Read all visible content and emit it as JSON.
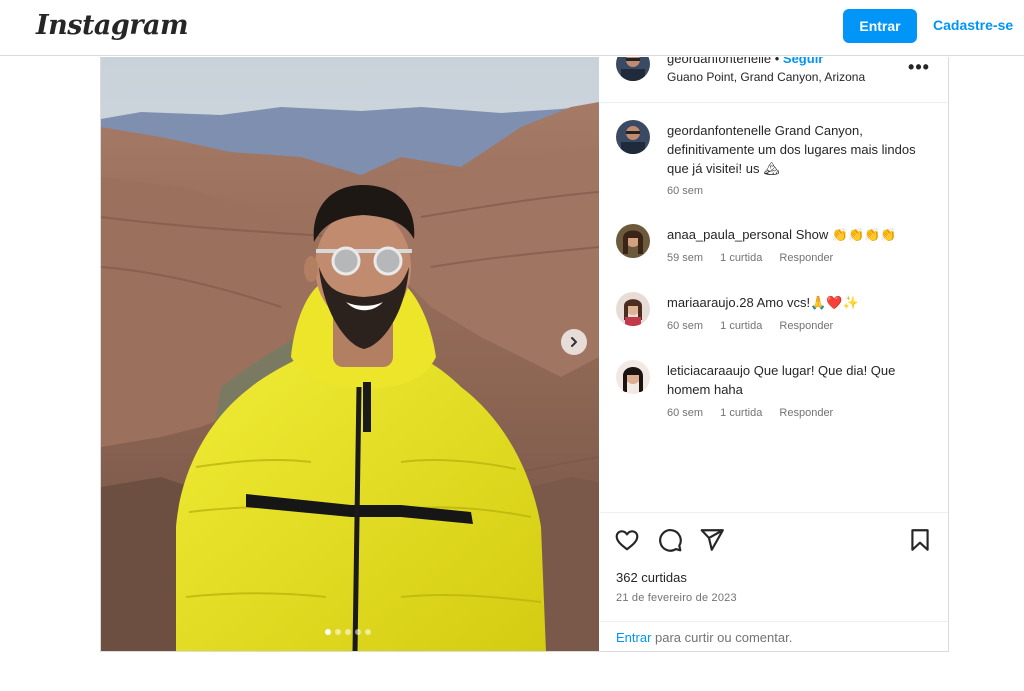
{
  "header": {
    "logo": "Instagram",
    "login_label": "Entrar",
    "signup_label": "Cadastre-se"
  },
  "post": {
    "username": "geordanfontenelle",
    "separator": "•",
    "follow_label": "Seguir",
    "location": "Guano Point, Grand Canyon, Arizona",
    "more_label": "•••",
    "caption": {
      "username": "geordanfontenelle",
      "text": "Grand Canyon, definitivamente um dos lugares mais lindos que já visitei! us 🏔",
      "time": "60 sem"
    },
    "comments": [
      {
        "username": "anaa_paula_personal",
        "text": "Show 👏👏👏👏",
        "time": "59 sem",
        "likes": "1 curtida",
        "reply": "Responder"
      },
      {
        "username": "mariaaraujo.28",
        "text": "Amo vcs!🙏❤️✨",
        "time": "60 sem",
        "likes": "1 curtida",
        "reply": "Responder"
      },
      {
        "username": "leticiacaraaujo",
        "text": "Que lugar! Que dia! Que homem haha",
        "time": "60 sem",
        "likes": "1 curtida",
        "reply": "Responder"
      }
    ],
    "likes_count": "362 curtidas",
    "date": "21 de fevereiro de 2023",
    "login_prompt_link": "Entrar",
    "login_prompt_text": " para curtir ou comentar.",
    "carousel": {
      "total": 5,
      "current": 1
    }
  },
  "colors": {
    "accent": "#0095f6",
    "border": "#dbdbdb",
    "muted_text": "#737373",
    "jacket": "#e6e01c"
  },
  "icons": [
    "heart-icon",
    "comment-icon",
    "share-icon",
    "bookmark-icon",
    "chevron-right-icon",
    "more-icon"
  ]
}
